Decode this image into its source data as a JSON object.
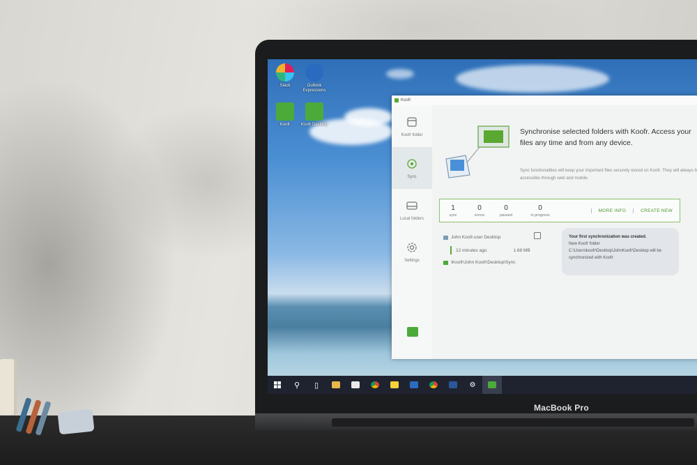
{
  "desktop": {
    "icons": [
      {
        "label": "Slack"
      },
      {
        "label": "Outlook Expressions"
      },
      {
        "label": "Koofr"
      },
      {
        "label": "Koofr Desktop"
      }
    ]
  },
  "app": {
    "title": "Koofr",
    "sidebar": [
      {
        "label": "Koofr folder",
        "icon": "folder-icon"
      },
      {
        "label": "Sync",
        "icon": "sync-icon",
        "active": true
      },
      {
        "label": "Local folders",
        "icon": "drive-icon"
      },
      {
        "label": "Settings",
        "icon": "gear-icon"
      }
    ],
    "hero": {
      "title": "Synchronise selected folders with Koofr. Access your files any time and from any device.",
      "subtitle": "Sync functionalities will keep your important files securely stored on Koofr. They will always be accessible through web and mobile."
    },
    "stats": [
      {
        "value": "1",
        "label": "sync"
      },
      {
        "value": "0",
        "label": "errors"
      },
      {
        "value": "0",
        "label": "paused"
      },
      {
        "value": "0",
        "label": "in progress"
      }
    ],
    "actions": {
      "more_info": "MORE INFO",
      "create_new": "CREATE NEW"
    },
    "sync_item": {
      "name": "John Koofr.user Desktop",
      "time": "12 minutes ago",
      "size": "1.68 MB",
      "path": "\\Koofr\\John Koofr\\Desktop\\Sync"
    },
    "notice": {
      "title": "Your first synchronization was created.",
      "line1": "New Koofr folder",
      "line2": "C:\\Users\\koofr\\Desktop\\JohnKoofr\\Desktop will be synchronized with Koofr"
    }
  },
  "laptop_label": "MacBook Pro",
  "colors": {
    "accent": "#4caa3a",
    "taskbar": "#1f2330",
    "window_bg": "#eef0f0"
  }
}
